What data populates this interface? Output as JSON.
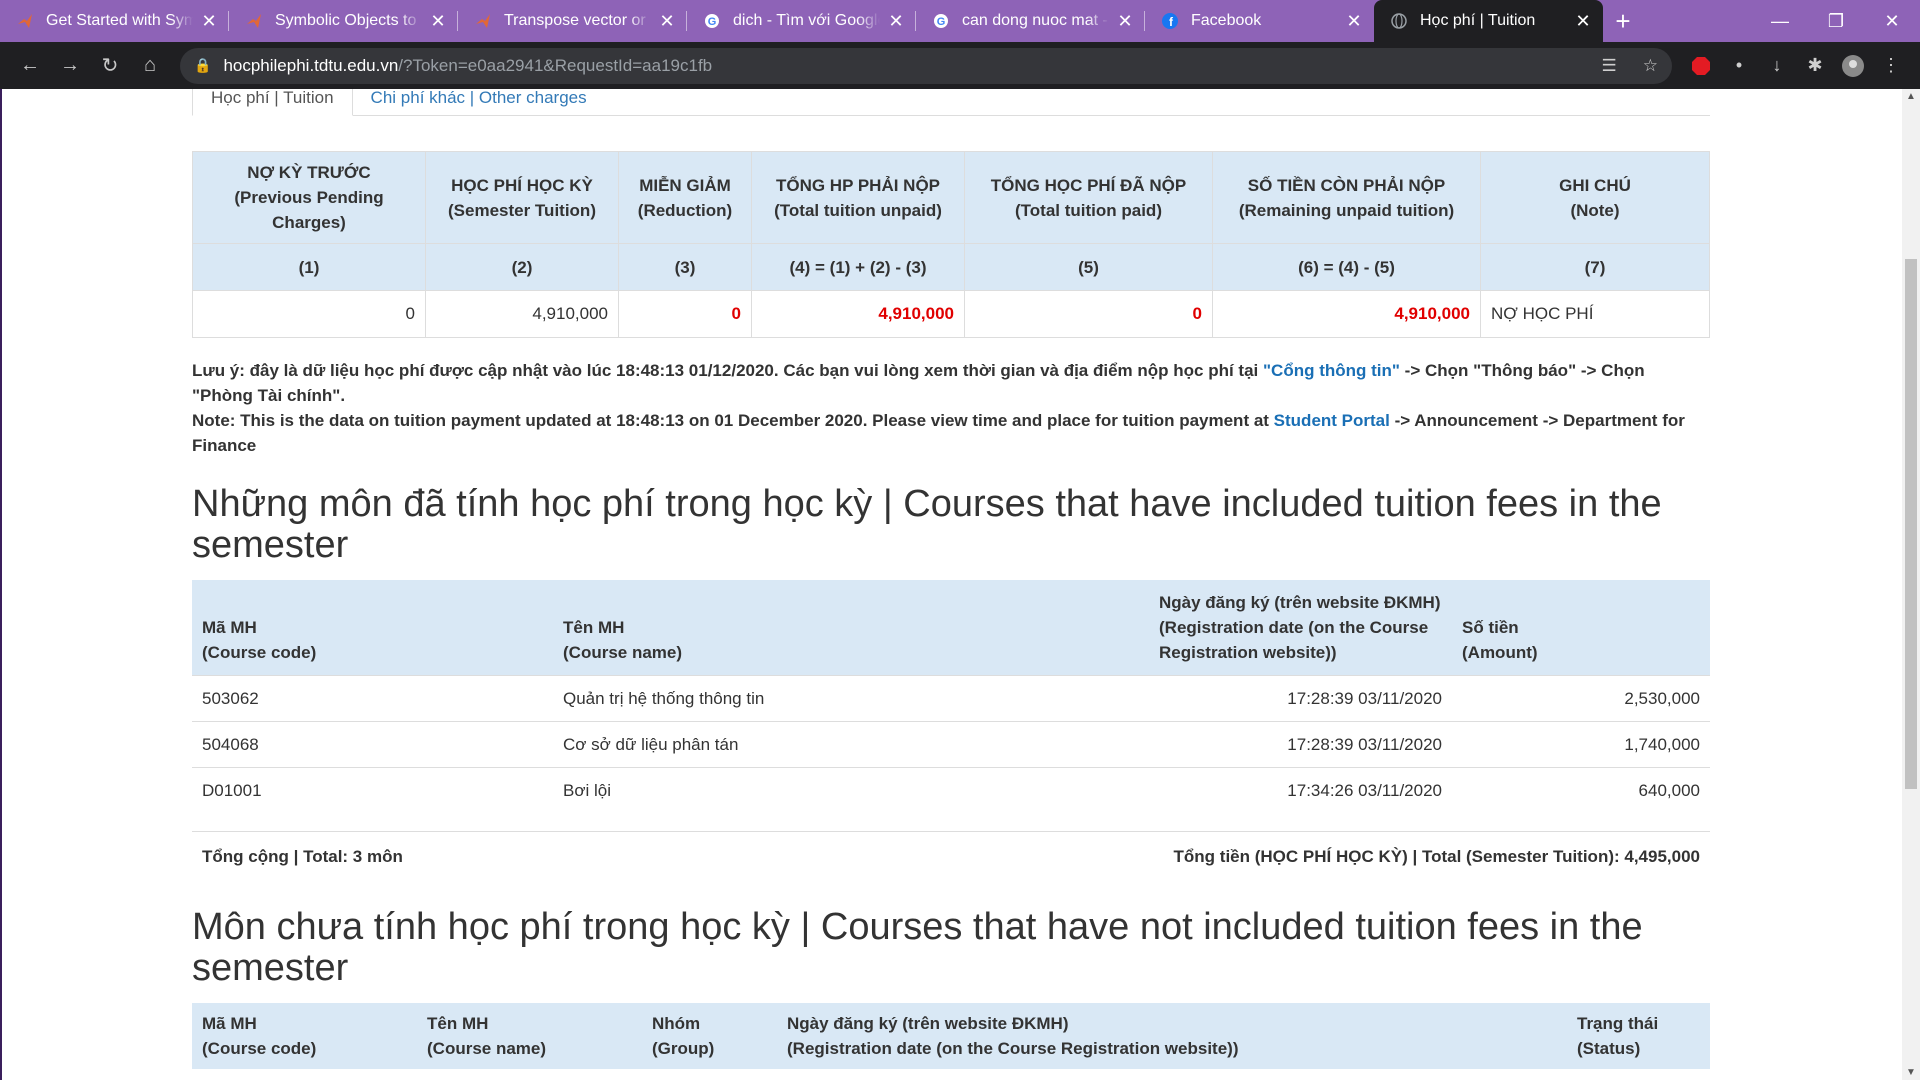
{
  "browser": {
    "tabs": [
      {
        "title": "Get Started with Symbolic",
        "icon": "matlab-icon",
        "active": false
      },
      {
        "title": "Symbolic Objects to Re",
        "icon": "matlab-icon",
        "active": false
      },
      {
        "title": "Transpose vector or ma",
        "icon": "matlab-icon",
        "active": false
      },
      {
        "title": "dich - Tìm với Google",
        "icon": "google-icon",
        "active": false
      },
      {
        "title": "can dong nuoc mat - T",
        "icon": "google-icon",
        "active": false
      },
      {
        "title": "Facebook",
        "icon": "facebook-icon",
        "active": false
      },
      {
        "title": "Học phí | Tuition",
        "icon": "globe-icon",
        "active": true
      }
    ],
    "url_host": "hocphilephi.tdtu.edu.vn",
    "url_path": "/?Token=e0aa2941&RequestId=aa19c1fb",
    "colors": {
      "tabbar": "#8e63b7",
      "toolbar": "#1f1f22"
    }
  },
  "page": {
    "tabs": {
      "tuition": "Học phí | Tuition",
      "other": "Chi phí khác | Other charges"
    },
    "summary": {
      "headers": [
        {
          "vn": "NỢ KỲ TRƯỚC",
          "en": "(Previous Pending Charges)",
          "idx": "(1)"
        },
        {
          "vn": "HỌC PHÍ HỌC KỲ",
          "en": "(Semester Tuition)",
          "idx": "(2)"
        },
        {
          "vn": "MIỄN GIẢM",
          "en": "(Reduction)",
          "idx": "(3)"
        },
        {
          "vn": "TỔNG HP PHẢI NỘP",
          "en": "(Total tuition unpaid)",
          "idx": "(4) = (1) + (2) - (3)"
        },
        {
          "vn": "TỔNG HỌC PHÍ ĐÃ NỘP",
          "en": "(Total tuition paid)",
          "idx": "(5)"
        },
        {
          "vn": "SỐ TIỀN CÒN PHẢI NỘP",
          "en": "(Remaining unpaid tuition)",
          "idx": "(6) = (4) - (5)"
        },
        {
          "vn": "GHI CHÚ",
          "en": "(Note)",
          "idx": "(7)"
        }
      ],
      "values": [
        "0",
        "4,910,000",
        "0",
        "4,910,000",
        "0",
        "4,910,000",
        "NỢ HỌC PHÍ"
      ]
    },
    "notice": {
      "vn_part1": "Lưu ý: đây là dữ liệu học phí được cập nhật vào lúc 18:48:13 01/12/2020. Các bạn vui lòng xem thời gian và địa điểm nộp học phí tại ",
      "vn_link": "\"Cổng thông tin\"",
      "vn_part2": " -> Chọn \"Thông báo\" -> Chọn \"Phòng Tài chính\".",
      "en_part1": "Note: This is the data on tuition payment updated at 18:48:13 on 01 December 2020. Please view time and place for tuition payment at ",
      "en_link": "Student Portal",
      "en_part2": " -> Announcement -> Department for Finance"
    },
    "included": {
      "heading": "Những môn đã tính học phí trong học kỳ | Courses that have included tuition fees in the semester",
      "headers": {
        "code": [
          "Mã MH",
          "(Course code)"
        ],
        "name": [
          "Tên MH",
          "(Course name)"
        ],
        "date": [
          "Ngày đăng ký (trên website ĐKMH)",
          "(Registration date (on the Course Registration website))"
        ],
        "amount": [
          "Số tiền",
          "(Amount)"
        ]
      },
      "rows": [
        {
          "code": "503062",
          "name": "Quản trị hệ thống thông tin",
          "date": "17:28:39 03/11/2020",
          "amount": "2,530,000"
        },
        {
          "code": "504068",
          "name": "Cơ sở dữ liệu phân tán",
          "date": "17:28:39 03/11/2020",
          "amount": "1,740,000"
        },
        {
          "code": "D01001",
          "name": "Bơi lội",
          "date": "17:34:26 03/11/2020",
          "amount": "640,000"
        }
      ],
      "total_count": "Tổng cộng | Total: 3 môn",
      "total_amount": "Tổng tiền (HỌC PHÍ HỌC KỲ) | Total (Semester Tuition): 4,495,000"
    },
    "not_included": {
      "heading": "Môn chưa tính học phí trong học kỳ | Courses that have not included tuition fees in the semester",
      "headers": {
        "code": [
          "Mã MH",
          "(Course code)"
        ],
        "name": [
          "Tên MH",
          "(Course name)"
        ],
        "group": [
          "Nhóm",
          "(Group)"
        ],
        "date": [
          "Ngày đăng ký (trên website ĐKMH)",
          "(Registration date (on the Course Registration website))"
        ],
        "status": [
          "Trạng thái",
          "(Status)"
        ]
      }
    }
  }
}
